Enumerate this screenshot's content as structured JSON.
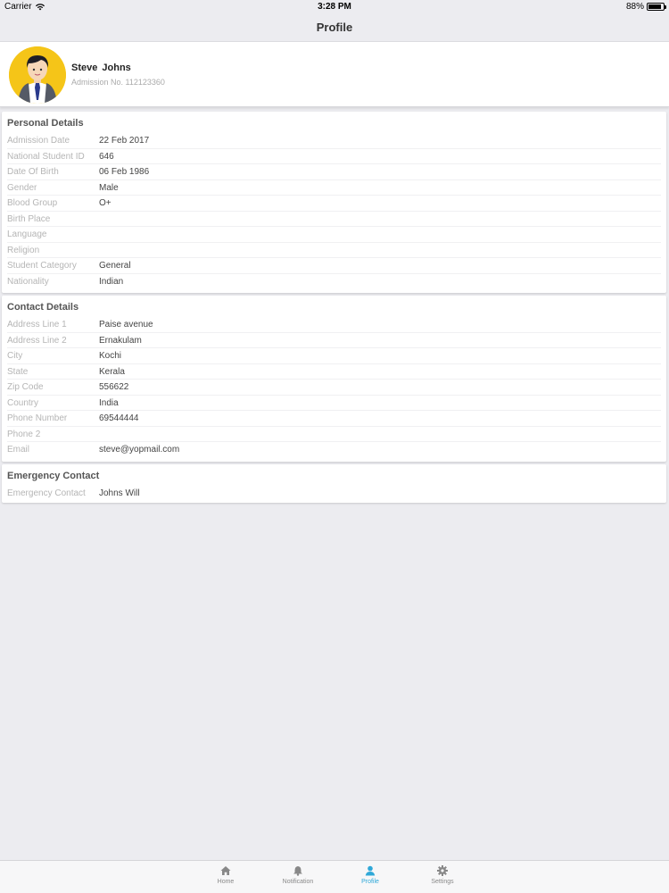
{
  "status_bar": {
    "carrier": "Carrier",
    "time": "3:28 PM",
    "battery": "88%",
    "battery_level": 0.88
  },
  "nav": {
    "title": "Profile"
  },
  "profile": {
    "name": "Steve  Johns",
    "admission": "Admission No. 112123360"
  },
  "personal": {
    "title": "Personal Details",
    "rows": [
      {
        "label": "Admission Date",
        "value": "22 Feb 2017"
      },
      {
        "label": "National Student ID",
        "value": "646"
      },
      {
        "label": "Date Of Birth",
        "value": "06 Feb 1986"
      },
      {
        "label": "Gender",
        "value": "Male"
      },
      {
        "label": "Blood Group",
        "value": "O+"
      },
      {
        "label": "Birth Place",
        "value": ""
      },
      {
        "label": "Language",
        "value": ""
      },
      {
        "label": "Religion",
        "value": ""
      },
      {
        "label": "Student Category",
        "value": "General"
      },
      {
        "label": "Nationality",
        "value": "Indian"
      }
    ]
  },
  "contact": {
    "title": "Contact Details",
    "rows": [
      {
        "label": "Address Line 1",
        "value": "Paise avenue"
      },
      {
        "label": "Address Line 2",
        "value": "Ernakulam"
      },
      {
        "label": "City",
        "value": "Kochi"
      },
      {
        "label": "State",
        "value": "Kerala"
      },
      {
        "label": "Zip Code",
        "value": "556622"
      },
      {
        "label": "Country",
        "value": "India"
      },
      {
        "label": "Phone Number",
        "value": "69544444"
      },
      {
        "label": "Phone 2",
        "value": ""
      },
      {
        "label": "Email",
        "value": "steve@yopmail.com"
      }
    ]
  },
  "emergency": {
    "title": "Emergency Contact",
    "rows": [
      {
        "label": "Emergency Contact",
        "value": "Johns Will"
      }
    ]
  },
  "tabs": [
    {
      "label": "Home",
      "icon": "home-icon"
    },
    {
      "label": "Notification",
      "icon": "bell-icon"
    },
    {
      "label": "Profile",
      "icon": "person-icon",
      "active": true
    },
    {
      "label": "Settings",
      "icon": "gear-icon"
    }
  ],
  "colors": {
    "accent": "#2fa8d8",
    "avatar_bg": "#f5c518",
    "background": "#ececf0"
  }
}
